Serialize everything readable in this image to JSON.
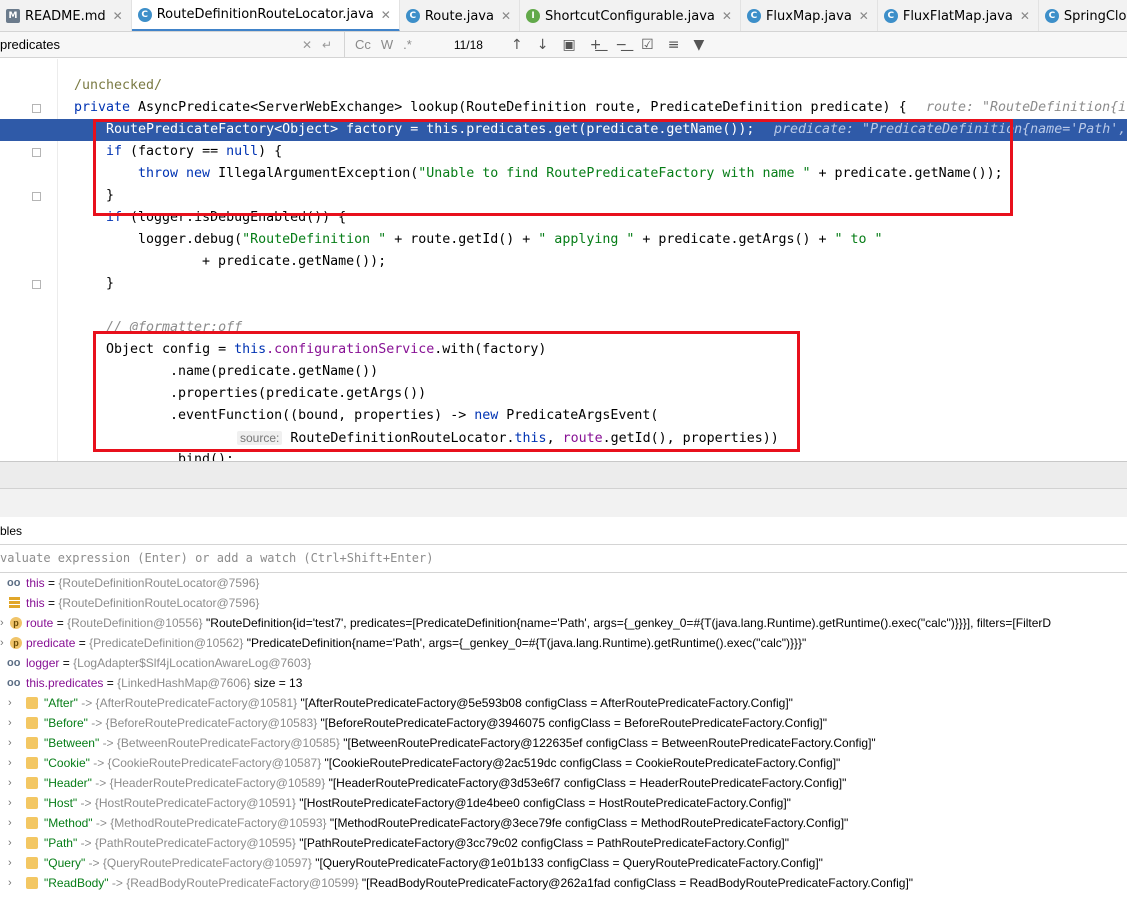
{
  "tabs": [
    {
      "label": "README.md",
      "icon": "markdown-file-icon",
      "active": false
    },
    {
      "label": "RouteDefinitionRouteLocator.java",
      "icon": "class-file-icon",
      "active": true
    },
    {
      "label": "Route.java",
      "icon": "class-file-icon",
      "active": false
    },
    {
      "label": "ShortcutConfigurable.java",
      "icon": "interface-file-icon",
      "active": false
    },
    {
      "label": "FluxMap.java",
      "icon": "class-file-icon",
      "active": false
    },
    {
      "label": "FluxFlatMap.java",
      "icon": "class-file-icon",
      "active": false
    },
    {
      "label": "SpringCloudGatewayDemoAppl",
      "icon": "class-file-icon",
      "active": false
    }
  ],
  "find": {
    "query": "predicates",
    "match_case": "Cc",
    "words": "W",
    "count": "11/18"
  },
  "code": {
    "l1_annotation": "/unchecked/",
    "l2_kw": "private",
    "l2_sig": " AsyncPredicate<ServerWebExchange> lookup(RouteDefinition route, PredicateDefinition predicate) {",
    "l2_hint": "route: \"RouteDefinition{i",
    "l3_code": "RoutePredicateFactory<Object> factory = this.predicates.get(predicate.getName());",
    "l3_hint": "predicate: \"PredicateDefinition{name='Path', a",
    "l4_kw": "if",
    "l4_a": " (factory == ",
    "l4_null": "null",
    "l4_b": ") {",
    "l5_throw": "throw",
    "l5_new": "new",
    "l5_a": " IllegalArgumentException(",
    "l5_str": "\"Unable to find RoutePredicateFactory with name \"",
    "l5_b": " + predicate.getName());",
    "l6": "}",
    "l7_kw": "if",
    "l7_a": " (logger.isDebugEnabled()) {",
    "l8_a": "logger.debug(",
    "l8_s1": "\"RouteDefinition \"",
    "l8_b": " + route.getId() + ",
    "l8_s2": "\" applying \"",
    "l8_c": " + predicate.getArgs() + ",
    "l8_s3": "\" to \"",
    "l9": "+ predicate.getName());",
    "l10": "}",
    "l11_comment": "// @formatter:off",
    "l12_a": "Object config = ",
    "l12_this": "this",
    "l12_field": ".configurationService",
    "l12_b": ".with(factory)",
    "l13": ".name(predicate.getName())",
    "l14": ".properties(predicate.getArgs())",
    "l15_a": ".eventFunction((bound, properties) -> ",
    "l15_new": "new",
    "l15_b": " PredicateArgsEvent(",
    "l16_param": "source:",
    "l16_a": " RouteDefinitionRouteLocator.",
    "l16_this": "this",
    "l16_b": ", ",
    "l16_route": "route",
    "l16_c": ".getId(), properties))",
    "l17": ".bind();"
  },
  "panel": {
    "variables_title": "bles",
    "watch_placeholder": "valuate expression (Enter) or add a watch (Ctrl+Shift+Enter)"
  },
  "variables": [
    {
      "icon": "watch-icon",
      "expand": false,
      "name": "this",
      "ref": "{RouteDefinitionRouteLocator@7596}",
      "value": "",
      "key": false
    },
    {
      "icon": "field-list-icon",
      "expand": false,
      "name": "this",
      "ref": "{RouteDefinitionRouteLocator@7596}",
      "value": "",
      "key": false
    },
    {
      "icon": "parameter-icon",
      "expand": true,
      "name": "route",
      "ref": "{RouteDefinition@10556}",
      "value": "\"RouteDefinition{id='test7', predicates=[PredicateDefinition{name='Path', args={_genkey_0=#{T(java.lang.Runtime).getRuntime().exec(\"calc\")}}}], filters=[FilterD",
      "key": false
    },
    {
      "icon": "parameter-icon",
      "expand": true,
      "name": "predicate",
      "ref": "{PredicateDefinition@10562}",
      "value": "\"PredicateDefinition{name='Path', args={_genkey_0=#{T(java.lang.Runtime).getRuntime().exec(\"calc\")}}}\"",
      "key": false
    },
    {
      "icon": "watch-icon",
      "expand": false,
      "name": "logger",
      "ref": "{LogAdapter$Slf4jLocationAwareLog@7603}",
      "value": "",
      "key": false
    },
    {
      "icon": "watch-icon",
      "expand": false,
      "name": "this.predicates",
      "ref": "{LinkedHashMap@7606}",
      "value": " size = 13",
      "key": false
    },
    {
      "icon": "entry-icon",
      "expand": true,
      "name": "\"After\"",
      "ref": "-> {AfterRoutePredicateFactory@10581}",
      "value": "\"[AfterRoutePredicateFactory@5e593b08 configClass = AfterRoutePredicateFactory.Config]\"",
      "key": true
    },
    {
      "icon": "entry-icon",
      "expand": true,
      "name": "\"Before\"",
      "ref": "-> {BeforeRoutePredicateFactory@10583}",
      "value": "\"[BeforeRoutePredicateFactory@3946075 configClass = BeforeRoutePredicateFactory.Config]\"",
      "key": true
    },
    {
      "icon": "entry-icon",
      "expand": true,
      "name": "\"Between\"",
      "ref": "-> {BetweenRoutePredicateFactory@10585}",
      "value": "\"[BetweenRoutePredicateFactory@122635ef configClass = BetweenRoutePredicateFactory.Config]\"",
      "key": true
    },
    {
      "icon": "entry-icon",
      "expand": true,
      "name": "\"Cookie\"",
      "ref": "-> {CookieRoutePredicateFactory@10587}",
      "value": "\"[CookieRoutePredicateFactory@2ac519dc configClass = CookieRoutePredicateFactory.Config]\"",
      "key": true
    },
    {
      "icon": "entry-icon",
      "expand": true,
      "name": "\"Header\"",
      "ref": "-> {HeaderRoutePredicateFactory@10589}",
      "value": "\"[HeaderRoutePredicateFactory@3d53e6f7 configClass = HeaderRoutePredicateFactory.Config]\"",
      "key": true
    },
    {
      "icon": "entry-icon",
      "expand": true,
      "name": "\"Host\"",
      "ref": "-> {HostRoutePredicateFactory@10591}",
      "value": "\"[HostRoutePredicateFactory@1de4bee0 configClass = HostRoutePredicateFactory.Config]\"",
      "key": true
    },
    {
      "icon": "entry-icon",
      "expand": true,
      "name": "\"Method\"",
      "ref": "-> {MethodRoutePredicateFactory@10593}",
      "value": "\"[MethodRoutePredicateFactory@3ece79fe configClass = MethodRoutePredicateFactory.Config]\"",
      "key": true
    },
    {
      "icon": "entry-icon",
      "expand": true,
      "name": "\"Path\"",
      "ref": "-> {PathRoutePredicateFactory@10595}",
      "value": "\"[PathRoutePredicateFactory@3cc79c02 configClass = PathRoutePredicateFactory.Config]\"",
      "key": true
    },
    {
      "icon": "entry-icon",
      "expand": true,
      "name": "\"Query\"",
      "ref": "-> {QueryRoutePredicateFactory@10597}",
      "value": "\"[QueryRoutePredicateFactory@1e01b133 configClass = QueryRoutePredicateFactory.Config]\"",
      "key": true
    },
    {
      "icon": "entry-icon",
      "expand": true,
      "name": "\"ReadBody\"",
      "ref": "-> {ReadBodyRoutePredicateFactory@10599}",
      "value": "\"[ReadBodyRoutePredicateFactory@262a1fad configClass = ReadBodyRoutePredicateFactory.Config]\"",
      "key": true
    }
  ]
}
